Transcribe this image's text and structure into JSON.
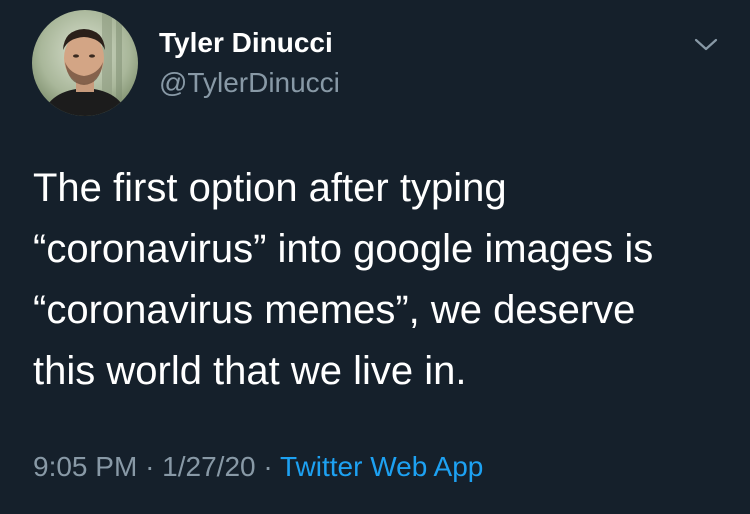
{
  "user": {
    "display_name": "Tyler Dinucci",
    "handle": "@TylerDinucci"
  },
  "tweet": {
    "lines": [
      "The first option after typing",
      "“coronavirus” into google images is",
      "“coronavirus memes”, we deserve",
      "this world that we live in."
    ],
    "time": "9:05 PM",
    "date": "1/27/20",
    "separator": "·",
    "source": "Twitter Web App"
  },
  "icons": {
    "menu": "chevron-down-icon"
  },
  "colors": {
    "background": "#15202b",
    "text": "#ffffff",
    "secondary": "#8899a6",
    "link": "#1da1f2"
  }
}
